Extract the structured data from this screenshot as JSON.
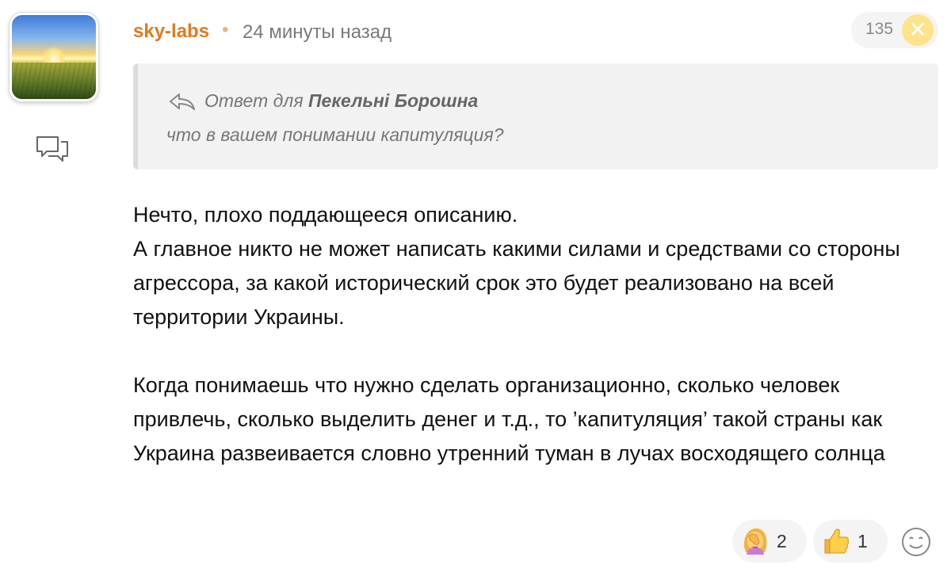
{
  "comment": {
    "author": "sky-labs",
    "separator": "•",
    "time": "24 минуты назад",
    "score": "135",
    "close_glyph": "✕",
    "reply": {
      "prefix": "Ответ для",
      "to": "Пекельні Борошна",
      "quoted_text": "что в вашем понимании капитуляция?"
    },
    "body": [
      "Нечто, плохо поддающееся описанию.",
      "А главное никто не может написать какими силами и средствами со стороны агрессора, за какой исторический срок это будет реализовано на всей территории Украины.",
      "",
      "Когда понимаешь что нужно сделать организационно, сколько человек привлечь, сколько выделить денег и т.д., то ’капитуляция’ такой страны как Украина развеивается словно утренний туман в лучах восходящего солнца"
    ],
    "reactions": [
      {
        "icon": "facepalm-emoji-icon",
        "count": "2"
      },
      {
        "icon": "thumbs-up-emoji-icon",
        "count": "1"
      }
    ]
  },
  "colors": {
    "author": "#e07a1e",
    "score_close_bg": "#ffe38a",
    "quote_bg": "#f2f2f2"
  }
}
